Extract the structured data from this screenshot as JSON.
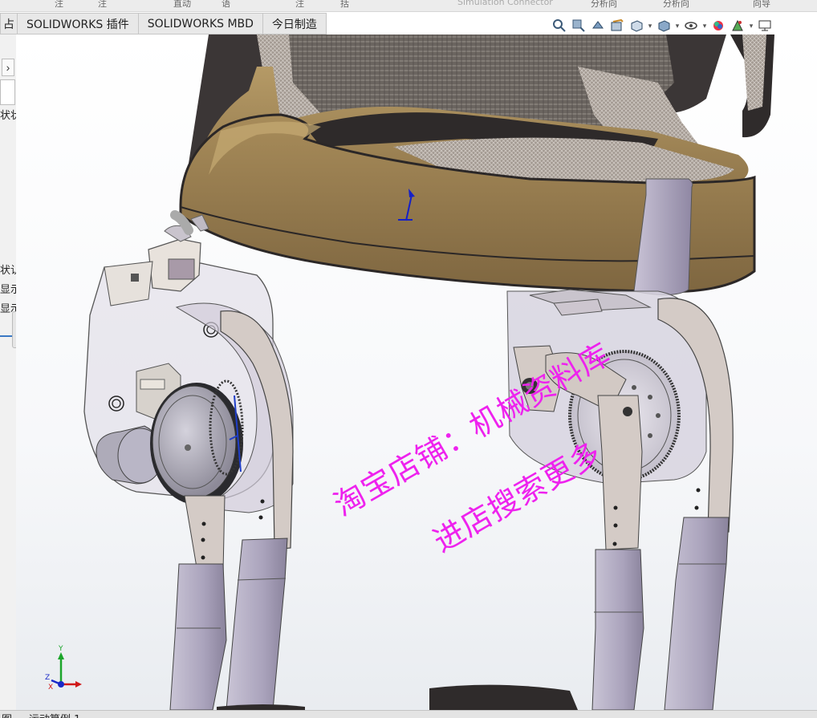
{
  "ribbon": {
    "fragments": [
      "注",
      "注",
      "直动",
      "语",
      "注",
      "括",
      "Simulation Connector",
      "分析向",
      "分析向",
      "向导"
    ]
  },
  "tabs": [
    {
      "label": "占"
    },
    {
      "label": "SOLIDWORKS 插件"
    },
    {
      "label": "SOLIDWORKS MBD"
    },
    {
      "label": "今日制造"
    }
  ],
  "view_toolbar": {
    "icons": [
      "zoom-to-fit-icon",
      "zoom-area-icon",
      "previous-view-icon",
      "section-view-icon",
      "view-orientation-icon",
      "display-style-icon",
      "hide-show-icon",
      "edit-appearance-icon",
      "scene-icon",
      "display-monitor-icon"
    ]
  },
  "left_panel": {
    "arrow": "›",
    "texts": [
      "状状",
      "状认",
      "显示",
      "显示"
    ]
  },
  "watermark": {
    "line1": "淘宝店铺：机械资料库",
    "line2": "进店搜索更多"
  },
  "triad": {
    "x": "X",
    "y": "Y",
    "z": "Z"
  },
  "bottom_tabs": [
    "图",
    "运动算例 1"
  ],
  "colors": {
    "tab_bg": "#e8e8e8",
    "viewport_bg": "#ffffff",
    "watermark": "#ee22ee",
    "fabric_brown": "#9c8355",
    "strap_dark": "#3b3636",
    "metal_lavender": "#b8b0c8"
  }
}
